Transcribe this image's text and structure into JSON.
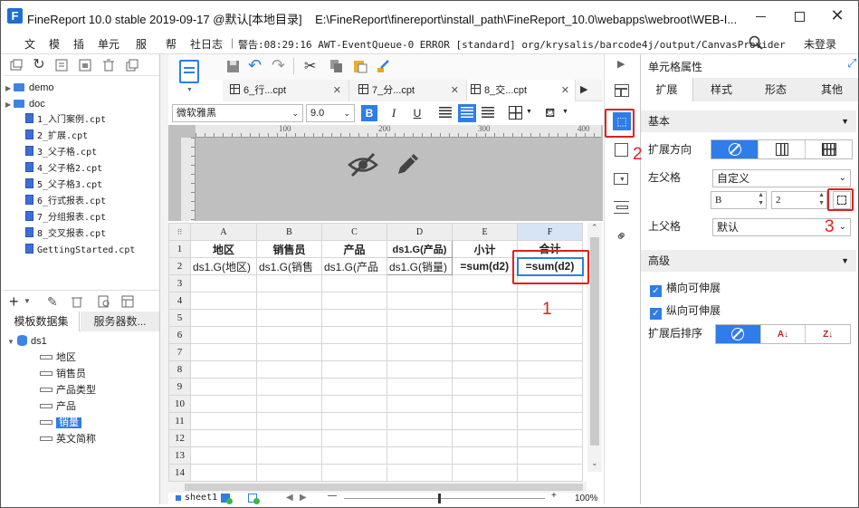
{
  "window": {
    "title": "FineReport 10.0 stable 2019-09-17 @默认[本地目录]",
    "path": "E:\\FineReport\\finereport\\install_path\\FineReport_10.0\\webapps\\webroot\\WEB-I..."
  },
  "menu": {
    "file": "文",
    "template": "模",
    "insert": "插",
    "cell": "单元",
    "server": "服",
    "help": "帮",
    "community": "社",
    "log": "日志",
    "warning": "警告:08:29:16 AWT-EventQueue-0 ERROR [standard] org/krysalis/barcode4j/output/CanvasProvider",
    "login": "未登录"
  },
  "tree": {
    "items": [
      {
        "label": "demo",
        "type": "folder"
      },
      {
        "label": "doc",
        "type": "folder"
      },
      {
        "label": "1_入门案例.cpt",
        "type": "file"
      },
      {
        "label": "2_扩展.cpt",
        "type": "file"
      },
      {
        "label": "3_父子格.cpt",
        "type": "file"
      },
      {
        "label": "4_父子格2.cpt",
        "type": "file"
      },
      {
        "label": "5_父子格3.cpt",
        "type": "file"
      },
      {
        "label": "6_行式报表.cpt",
        "type": "file"
      },
      {
        "label": "7_分组报表.cpt",
        "type": "file"
      },
      {
        "label": "8_交叉报表.cpt",
        "type": "file"
      },
      {
        "label": "GettingStarted.cpt",
        "type": "file"
      }
    ]
  },
  "dataset_panel": {
    "tab_template": "模板数据集",
    "tab_server": "服务器数...",
    "dataset": "ds1",
    "fields": [
      "地区",
      "销售员",
      "产品类型",
      "产品",
      "销量",
      "英文简称"
    ],
    "selected_field": "销量"
  },
  "tabs": [
    {
      "label": "6_行...cpt"
    },
    {
      "label": "7_分...cpt"
    },
    {
      "label": "8_交...cpt"
    }
  ],
  "format_bar": {
    "font": "微软雅黑",
    "size": "9.0",
    "bold": "B",
    "italic": "I",
    "underline": "U"
  },
  "ruler": {
    "ticks": [
      "100",
      "200",
      "300",
      "400"
    ]
  },
  "sheet": {
    "columns": [
      "A",
      "B",
      "C",
      "D",
      "E",
      "F"
    ],
    "rows": [
      "1",
      "2",
      "3",
      "4",
      "5",
      "6",
      "7",
      "8",
      "9",
      "10",
      "11",
      "12",
      "13",
      "14"
    ],
    "row1": [
      "地区",
      "销售员",
      "产品",
      "ds1.G(产品)",
      "小计",
      "合计"
    ],
    "row2": [
      "ds1.G(地区)",
      "ds1.G(销售",
      "ds1.G(产品",
      "ds1.G(销量)",
      "=sum(d2)",
      "=sum(d2)"
    ]
  },
  "bottom": {
    "sheet": "sheet1",
    "zoom": "100%",
    "minus": "—",
    "plus": "+"
  },
  "right_panel": {
    "title": "单元格属性",
    "tabs": [
      "扩展",
      "样式",
      "形态",
      "其他"
    ],
    "basic": "基本",
    "expand_direction": "扩展方向",
    "left_parent": "左父格",
    "left_parent_value": "自定义",
    "col_value": "B",
    "row_value": "2",
    "upper_parent": "上父格",
    "upper_parent_value": "默认",
    "advanced": "高级",
    "horizontal_expandable": "横向可伸展",
    "vertical_expandable": "纵向可伸展",
    "sort_after_expand": "扩展后排序"
  },
  "annotations": {
    "n1": "1",
    "n2": "2",
    "n3": "3"
  },
  "colors": {
    "accent": "#2e7de8",
    "annotation": "#e02020"
  }
}
